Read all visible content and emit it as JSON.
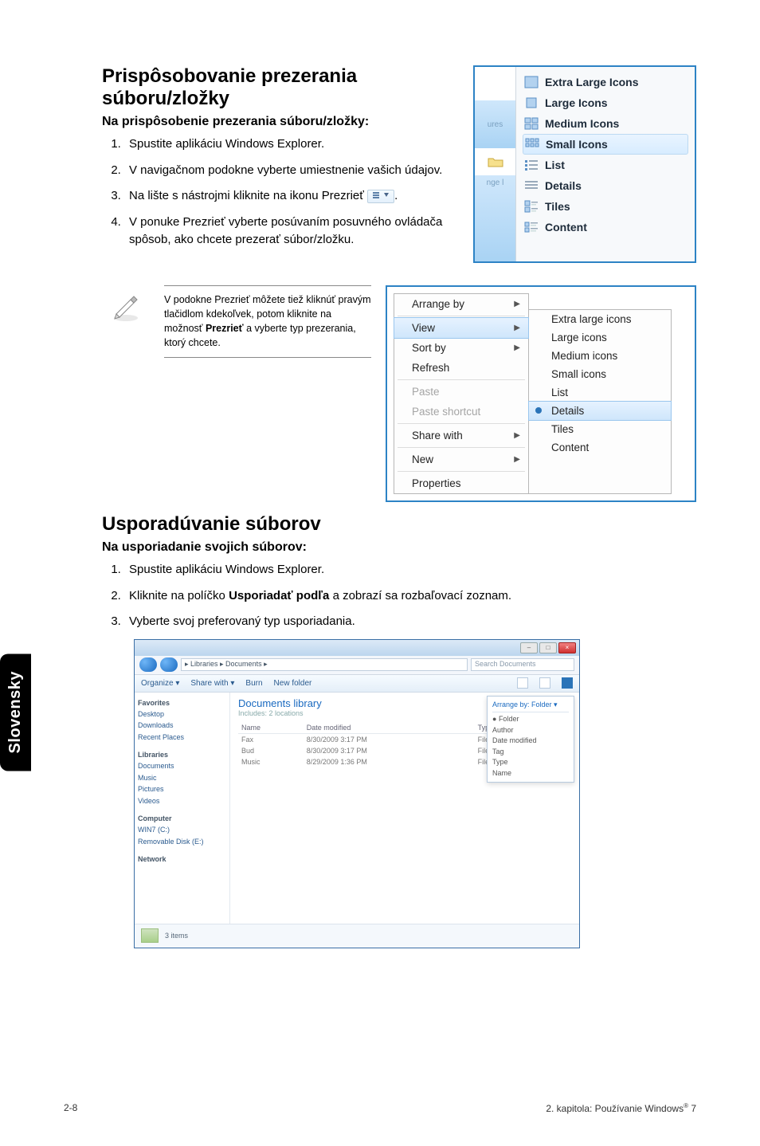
{
  "sideTab": "Slovensky",
  "section1": {
    "heading": "Prispôsobovanie prezerania súboru/zložky",
    "subhead": "Na prispôsobenie prezerania súboru/zložky:",
    "steps": [
      "Spustite aplikáciu Windows Explorer.",
      "V navigačnom podokne vyberte umiestnenie vašich údajov.",
      "Na lište s nástrojmi kliknite na ikonu Prezrieť",
      "V ponuke Prezrieť vyberte posúvaním posuvného ovládača spôsob, ako chcete prezerať súbor/zložku."
    ],
    "step3_tail": "."
  },
  "viewPanel": {
    "gutter": {
      "top": "ures",
      "mid_icon": "folder",
      "bottom": "nge l"
    },
    "items": [
      "Extra Large Icons",
      "Large Icons",
      "Medium Icons",
      "Small Icons",
      "List",
      "Details",
      "Tiles",
      "Content"
    ],
    "selected": "Small Icons"
  },
  "note": {
    "text_a": "V podokne Prezrieť môžete tiež kliknúť pravým tlačidlom kdekoľvek, potom kliknite na možnosť ",
    "bold": "Prezrieť",
    "text_b": " a vyberte typ prezerania, ktorý chcete."
  },
  "contextMenu": {
    "items": [
      {
        "label": "Arrange by",
        "arrow": true
      },
      {
        "label": "View",
        "arrow": true,
        "selected": true
      },
      {
        "label": "Sort by",
        "arrow": true
      },
      {
        "label": "Refresh"
      },
      {
        "label": "Paste",
        "disabled": true
      },
      {
        "label": "Paste shortcut",
        "disabled": true
      },
      {
        "label": "Share with",
        "arrow": true
      },
      {
        "label": "New",
        "arrow": true
      },
      {
        "label": "Properties"
      }
    ],
    "submenu": [
      {
        "label": "Extra large icons"
      },
      {
        "label": "Large icons"
      },
      {
        "label": "Medium icons"
      },
      {
        "label": "Small icons"
      },
      {
        "label": "List"
      },
      {
        "label": "Details",
        "selected": true,
        "dot": true
      },
      {
        "label": "Tiles"
      },
      {
        "label": "Content"
      }
    ]
  },
  "section2": {
    "heading": "Usporadúvanie súborov",
    "subhead": "Na usporiadanie svojich súborov:",
    "steps": [
      "Spustite aplikáciu Windows Explorer.",
      "Kliknite na políčko Usporiadať podľa a zobrazí sa rozbaľovací zoznam.",
      "Vyberte svoj preferovaný typ usporiadania."
    ],
    "step2_pre": "Kliknite na políčko ",
    "step2_bold": "Usporiadať podľa",
    "step2_post": " a zobrazí sa rozbaľovací zoznam."
  },
  "explorer": {
    "breadcrumb": "▸ Libraries ▸ Documents ▸",
    "searchPlaceholder": "Search Documents",
    "toolbar": [
      "Organize ▾",
      "Share with ▾",
      "Burn",
      "New folder"
    ],
    "sidebar": {
      "favorites": {
        "title": "Favorites",
        "items": [
          "Desktop",
          "Downloads",
          "Recent Places"
        ]
      },
      "libraries": {
        "title": "Libraries",
        "items": [
          "Documents",
          "Music",
          "Pictures",
          "Videos"
        ]
      },
      "computer": {
        "title": "Computer",
        "items": [
          "WIN7 (C:)",
          "Removable Disk (E:)"
        ]
      },
      "network": {
        "title": "Network"
      }
    },
    "library": {
      "title": "Documents library",
      "subtitle": "Includes: 2 locations"
    },
    "columns": [
      "Name",
      "Date modified",
      "Type"
    ],
    "rows": [
      {
        "name": "Fax",
        "date": "8/30/2009 3:17 PM",
        "type": "File folder"
      },
      {
        "name": "Bud",
        "date": "8/30/2009 3:17 PM",
        "type": "File folder"
      },
      {
        "name": "Music",
        "date": "8/29/2009 1:36 PM",
        "type": "File folder"
      }
    ],
    "arrange": {
      "header": "Arrange by:  Folder ▾",
      "options": [
        "Folder",
        "Author",
        "Date modified",
        "Tag",
        "Type",
        "Name"
      ],
      "selected": "Folder"
    },
    "status": "3 items"
  },
  "footer": {
    "left": "2-8",
    "right_a": "2. kapitola: Používanie Windows",
    "right_reg": "®",
    "right_b": " 7"
  }
}
